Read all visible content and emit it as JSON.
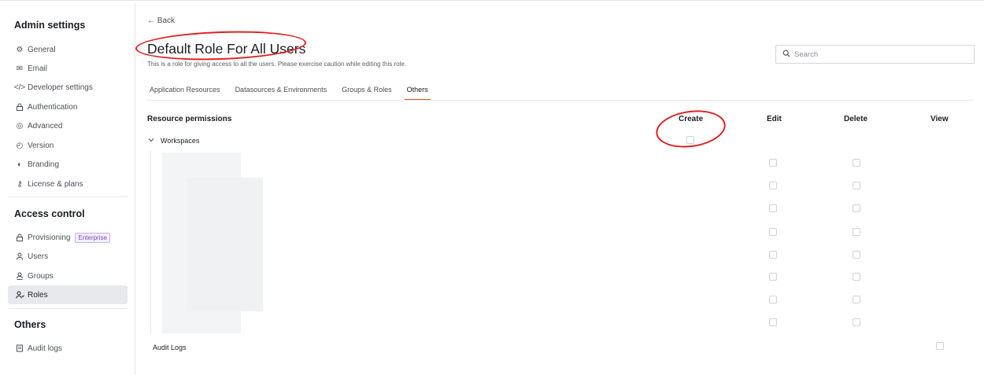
{
  "sidebar": {
    "sections": [
      {
        "title": "Admin settings",
        "items": [
          {
            "label": "General",
            "icon": "gear-icon"
          },
          {
            "label": "Email",
            "icon": "mail-icon"
          },
          {
            "label": "Developer settings",
            "icon": "code-icon"
          },
          {
            "label": "Authentication",
            "icon": "lock-icon"
          },
          {
            "label": "Advanced",
            "icon": "advanced-icon"
          },
          {
            "label": "Version",
            "icon": "clock-icon"
          },
          {
            "label": "Branding",
            "icon": "palette-icon"
          },
          {
            "label": "License & plans",
            "icon": "key-icon"
          }
        ]
      },
      {
        "title": "Access control",
        "items": [
          {
            "label": "Provisioning",
            "icon": "lock-icon",
            "badge": "Enterprise"
          },
          {
            "label": "Users",
            "icon": "user-icon"
          },
          {
            "label": "Groups",
            "icon": "group-icon"
          },
          {
            "label": "Roles",
            "icon": "roles-icon",
            "active": true
          }
        ]
      },
      {
        "title": "Others",
        "items": [
          {
            "label": "Audit logs",
            "icon": "document-icon"
          }
        ]
      }
    ]
  },
  "header": {
    "back_label": "← Back",
    "title": "Default Role For All Users",
    "subtitle": "This is a role for giving access to all the users. Please exercise caution while editing this role."
  },
  "search": {
    "placeholder": "Search",
    "value": ""
  },
  "tabs": [
    {
      "label": "Application Resources"
    },
    {
      "label": "Datasources & Environments"
    },
    {
      "label": "Groups & Roles"
    },
    {
      "label": "Others",
      "active": true
    }
  ],
  "table": {
    "columns": [
      "Resource permissions",
      "Create",
      "Edit",
      "Delete",
      "View"
    ],
    "rows": [
      {
        "label": "Workspaces"
      },
      {
        "label": "Audit Logs"
      }
    ]
  },
  "colors": {
    "accent": "#e15615",
    "annotation": "#e02020",
    "active_nav_bg": "#e8e9ec",
    "badge": "#7a4fbf"
  }
}
